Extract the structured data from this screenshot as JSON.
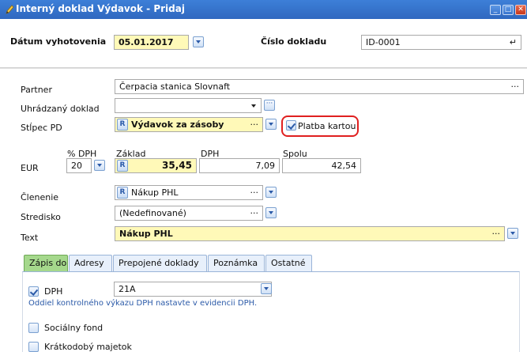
{
  "window": {
    "title": "Interný doklad Výdavok - Pridaj",
    "minimize_glyph": "_",
    "maximize_glyph": "□",
    "close_glyph": "✕"
  },
  "header": {
    "date_label": "Dátum vyhotovenia",
    "date_value": "05.01.2017",
    "number_label": "Číslo dokladu",
    "number_value": "ID-0001",
    "number_icon_glyph": "↵"
  },
  "form": {
    "partner_label": "Partner",
    "partner_value": "Čerpacia stanica Slovnaft",
    "uhr_label": "Uhrádzaný doklad",
    "uhr_value": "",
    "stlpec_label": "Stĺpec PD",
    "stlpec_badge": "R",
    "stlpec_value": "Výdavok za zásoby",
    "platba_label": "Platba kartou",
    "vat_col_label": "% DPH",
    "zaklad_col_label": "Základ",
    "dph_col_label": "DPH",
    "spolu_col_label": "Spolu",
    "currency_label": "EUR",
    "vat_rate": "20",
    "zaklad_badge": "R",
    "zaklad_value": "35,45",
    "dph_value": "7,09",
    "spolu_value": "42,54",
    "clenenie_label": "Členenie",
    "clenenie_badge": "R",
    "clenenie_value": "Nákup PHL",
    "stredisko_label": "Stredisko",
    "stredisko_value": "(Nedefinované)",
    "text_label": "Text",
    "text_value": "Nákup PHL",
    "ellipsis": "···"
  },
  "tabs": [
    {
      "label": "Zápis do",
      "active": true
    },
    {
      "label": "Adresy",
      "active": false
    },
    {
      "label": "Prepojené doklady",
      "active": false
    },
    {
      "label": "Poznámka",
      "active": false
    },
    {
      "label": "Ostatné",
      "active": false
    }
  ],
  "zapis": {
    "dph_label": "DPH",
    "dph_checked": true,
    "dph_value": "21A",
    "dph_note": "Oddiel kontrolného výkazu DPH nastavte v evidencii DPH.",
    "socialny_label": "Sociálny fond",
    "kratkodoby_label": "Krátkodobý majetok"
  },
  "colors": {
    "titlebar": "#2f68c0",
    "highlight": "#e02020",
    "yellow_field": "#fff9b8",
    "active_tab": "#a5d88c",
    "link_blue": "#2b5aa8"
  }
}
